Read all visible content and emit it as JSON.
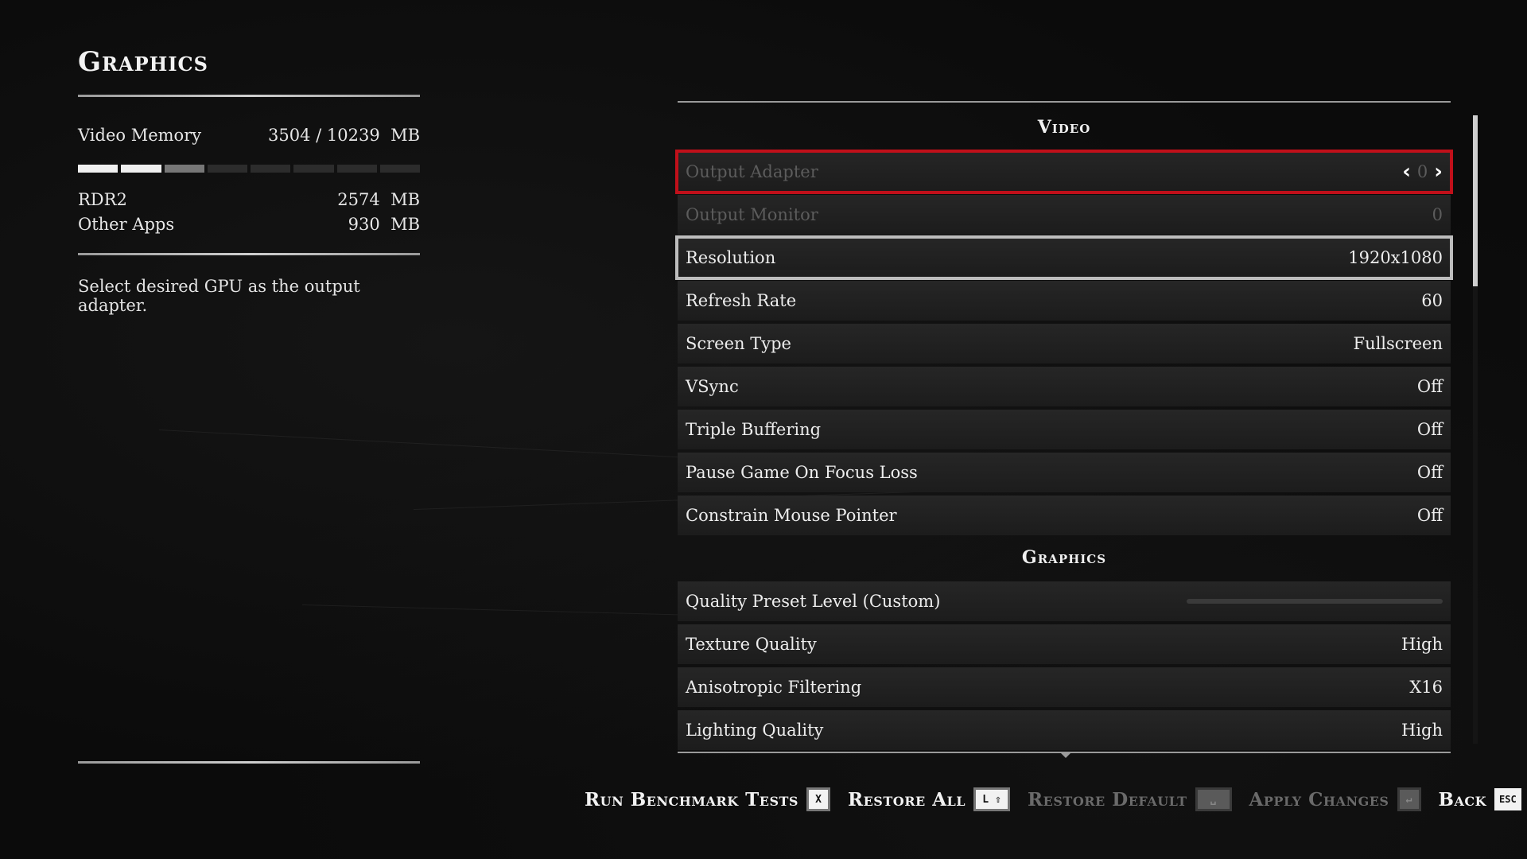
{
  "left_panel": {
    "title": "Graphics",
    "video_memory": {
      "label": "Video Memory",
      "used": "3504",
      "total": "/ 10239",
      "unit": "MB",
      "bar": {
        "segments_full": 2,
        "segments_partial": 1,
        "segments_total": 8
      }
    },
    "rdr2": {
      "label": "RDR2",
      "value": "2574",
      "unit": "MB"
    },
    "other_apps": {
      "label": "Other Apps",
      "value": "930",
      "unit": "MB"
    },
    "description": "Select desired GPU as the output adapter."
  },
  "settings": {
    "video_header": "Video",
    "graphics_header": "Graphics",
    "rows": {
      "output_adapter": {
        "label": "Output Adapter",
        "value": "0"
      },
      "output_monitor": {
        "label": "Output Monitor",
        "value": "0"
      },
      "resolution": {
        "label": "Resolution",
        "value": "1920x1080"
      },
      "refresh_rate": {
        "label": "Refresh Rate",
        "value": "60"
      },
      "screen_type": {
        "label": "Screen Type",
        "value": "Fullscreen"
      },
      "vsync": {
        "label": "VSync",
        "value": "Off"
      },
      "triple_buffering": {
        "label": "Triple Buffering",
        "value": "Off"
      },
      "pause_game": {
        "label": "Pause Game On Focus Loss",
        "value": "Off"
      },
      "constrain_mouse": {
        "label": "Constrain Mouse Pointer",
        "value": "Off"
      },
      "quality_preset": {
        "label": "Quality Preset Level (Custom)"
      },
      "texture_quality": {
        "label": "Texture Quality",
        "value": "High"
      },
      "anisotropic": {
        "label": "Anisotropic Filtering",
        "value": "X16"
      },
      "lighting_quality": {
        "label": "Lighting Quality",
        "value": "High"
      }
    }
  },
  "footer": {
    "run_benchmark": {
      "label": "Run Benchmark Tests",
      "key": "X"
    },
    "restore_all": {
      "label": "Restore All",
      "key": "L ⇧"
    },
    "restore_default": {
      "label": "Restore Default",
      "key": "␣"
    },
    "apply_changes": {
      "label": "Apply Changes",
      "key": "↵"
    },
    "back": {
      "label": "Back",
      "key": "ESC"
    }
  },
  "colors": {
    "selected_outline": "#c0101a",
    "hover_outline": "#bdbdbd",
    "background": "#0b0b0b"
  }
}
